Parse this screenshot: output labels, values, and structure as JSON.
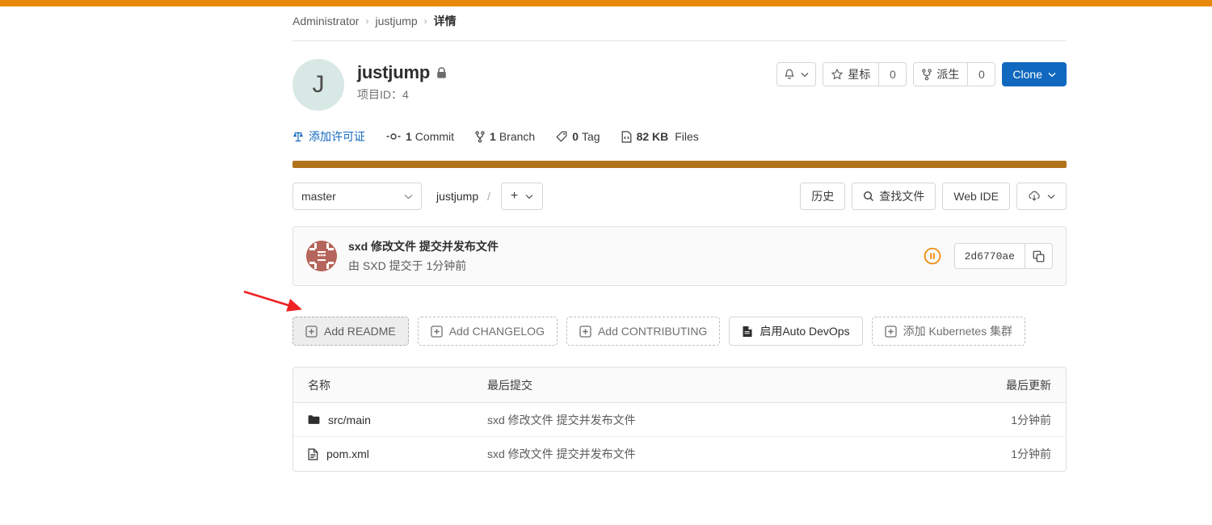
{
  "theme": {
    "top_bar_color": "#e8890c",
    "language_bar_color": "#b07219",
    "primary_button_color": "#1068bf",
    "link_color": "#1068bf",
    "annotation_arrow_color": "#ee2222"
  },
  "breadcrumb": {
    "owner": "Administrator",
    "project": "justjump",
    "current": "详情",
    "separator": "›"
  },
  "project": {
    "avatar_letter": "J",
    "name": "justjump",
    "visibility_icon": "lock-icon",
    "id_label": "项目ID：4"
  },
  "header_actions": {
    "notification_icon": "bell-icon",
    "star_label": "星标",
    "star_count": "0",
    "fork_label": "派生",
    "fork_count": "0",
    "clone_label": "Clone"
  },
  "stats": {
    "license_link": "添加许可证",
    "commits_count": "1",
    "commits_label": "Commit",
    "branches_count": "1",
    "branches_label": "Branch",
    "tags_count": "0",
    "tags_label": "Tag",
    "size_value": "82 KB",
    "size_label": "Files"
  },
  "toolbar": {
    "branch": "master",
    "path_root": "justjump",
    "path_separator": "/",
    "plus_label": "+",
    "history_label": "历史",
    "find_file_label": "查找文件",
    "web_ide_label": "Web IDE",
    "download_icon": "download-cloud-icon"
  },
  "commit": {
    "title": "sxd 修改文件 提交并发布文件",
    "subtitle": "由 SXD 提交于 1分钟前",
    "ci_status_icon": "pipeline-pending-icon",
    "sha": "2d6770ae",
    "copy_icon": "copy-icon"
  },
  "add_buttons": [
    {
      "label": "Add README",
      "icon": "plus-square-icon",
      "state": "hovered",
      "style": "dashed"
    },
    {
      "label": "Add CHANGELOG",
      "icon": "plus-square-icon",
      "state": "default",
      "style": "dashed"
    },
    {
      "label": "Add CONTRIBUTING",
      "icon": "plus-square-icon",
      "state": "default",
      "style": "dashed"
    },
    {
      "label": "启用Auto DevOps",
      "icon": "doc-icon",
      "state": "default",
      "style": "solid"
    },
    {
      "label": "添加 Kubernetes 集群",
      "icon": "plus-square-icon",
      "state": "default",
      "style": "dashed"
    }
  ],
  "file_table": {
    "headers": {
      "name": "名称",
      "last_commit": "最后提交",
      "last_update": "最后更新"
    },
    "rows": [
      {
        "name": "src/main",
        "icon": "folder-icon",
        "last_commit": "sxd 修改文件 提交并发布文件",
        "last_update": "1分钟前"
      },
      {
        "name": "pom.xml",
        "icon": "file-icon",
        "last_commit": "sxd 修改文件 提交并发布文件",
        "last_update": "1分钟前"
      }
    ]
  }
}
